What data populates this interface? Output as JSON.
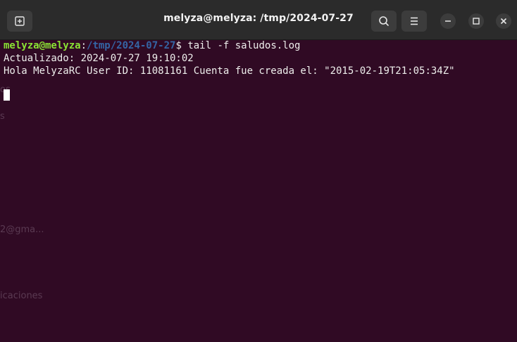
{
  "window": {
    "title": "melyza@melyza: /tmp/2024-07-27"
  },
  "titlebar": {
    "icons": [
      "new-tab-icon",
      "search-icon",
      "hamburger-menu-icon",
      "minimize-icon",
      "maximize-icon",
      "close-icon"
    ]
  },
  "background_bleed": {
    "text_1": "s",
    "text_2": "os",
    "text_3": "s",
    "text_4": "2@gma...",
    "text_5": "icaciones"
  },
  "terminal": {
    "prompt_user": "melyza@melyza",
    "prompt_sep": ":",
    "prompt_path": "/tmp/2024-07-27",
    "prompt_symbol": "$",
    "command": " tail -f saludos.log",
    "output": [
      "Actualizado: 2024-07-27 19:10:02",
      "Hola MelyzaRC User ID: 11081161 Cuenta fue creada el: \"2015-02-19T21:05:34Z\""
    ]
  },
  "colors": {
    "terminal_bg": "#300a24",
    "titlebar_bg": "#2b2b2b",
    "prompt_user": "#8ae234",
    "prompt_path": "#3465a4",
    "text": "#eeeeec"
  }
}
